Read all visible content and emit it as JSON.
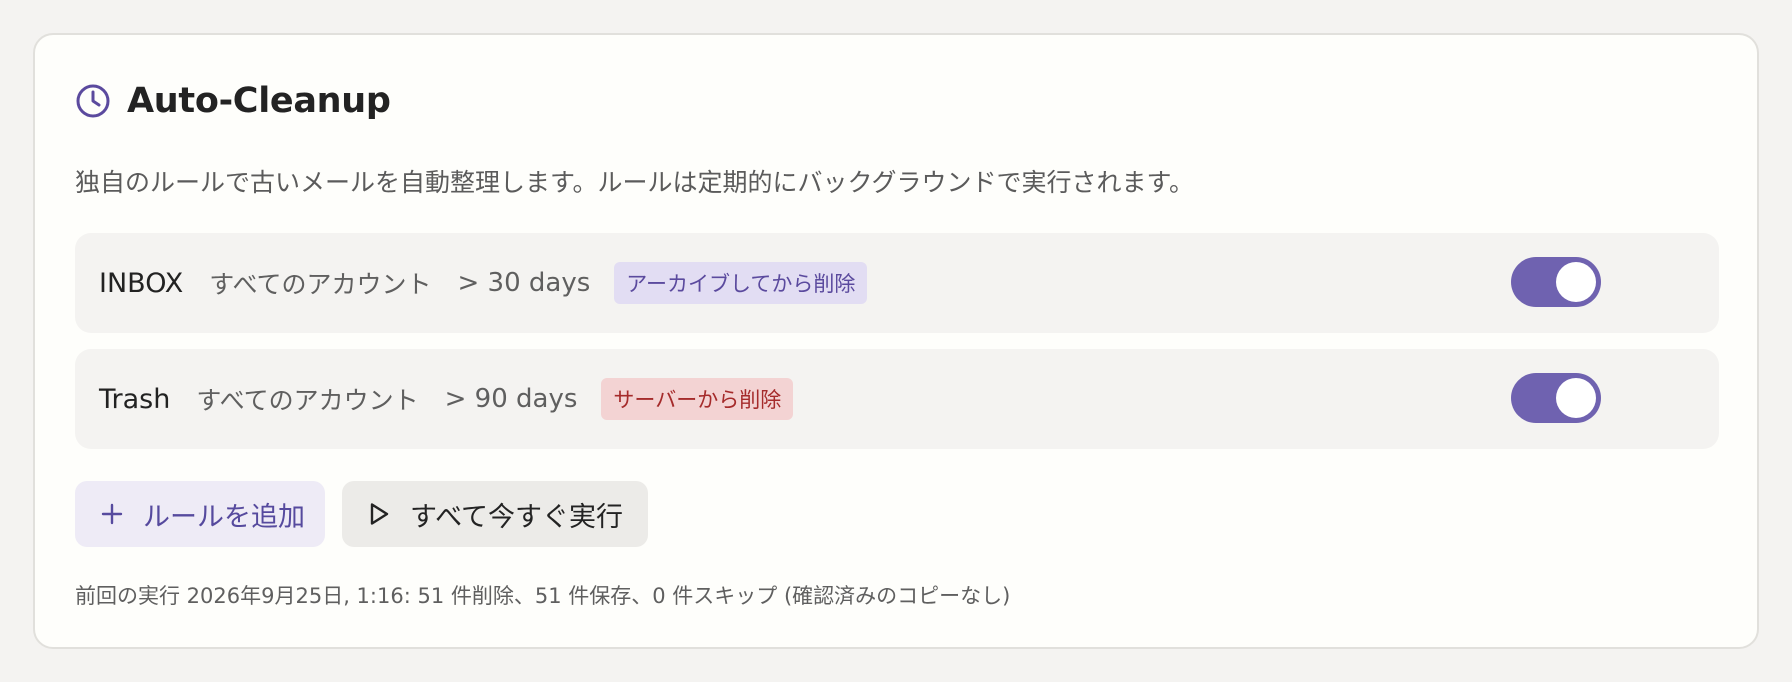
{
  "header": {
    "icon": "clock-icon",
    "title": "Auto-Cleanup",
    "accent": "#5b4a9e"
  },
  "description": "独自のルールで古いメールを自動整理します。ルールは定期的にバックグラウンドで実行されます。",
  "rules": [
    {
      "folder": "INBOX",
      "account": "すべてのアカウント",
      "age": "> 30 days",
      "action": "アーカイブしてから削除",
      "action_color": "#5b4a9e",
      "enabled": true
    },
    {
      "folder": "Trash",
      "account": "すべてのアカウント",
      "age": "> 90 days",
      "action": "サーバーから削除",
      "action_color": "#a52b2b",
      "enabled": true
    }
  ],
  "actions": {
    "add_label": "ルールを追加",
    "add_icon": "plus-icon",
    "run_label": "すべて今すぐ実行",
    "run_icon": "play-icon"
  },
  "last_run": "前回の実行 2026年9月25日, 1:16: 51 件削除、51 件保存、0 件スキップ (確認済みのコピーなし)"
}
